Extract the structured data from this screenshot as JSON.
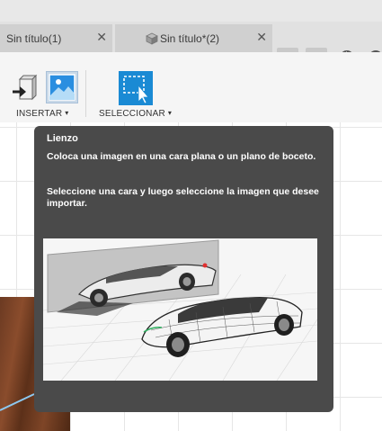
{
  "tabs": [
    {
      "label": "Sin título(1)",
      "close": "✕"
    },
    {
      "label": "Sin título*(2)",
      "close": "✕"
    }
  ],
  "tab_controls": {
    "overflow_icon": "chevron-down-icon",
    "add_label": "+",
    "sync_icon": "refresh-icon"
  },
  "toolbar": {
    "insert": {
      "label": "INSERTAR",
      "caret": "▾"
    },
    "select": {
      "label": "SELECCIONAR",
      "caret": "▾"
    }
  },
  "tooltip": {
    "title": "Lienzo",
    "description": "Coloca una imagen en una cara plana o un plano de boceto.",
    "instruction": "Seleccione una cara y luego seleccione la imagen que desee importar."
  },
  "colors": {
    "accent_blue": "#1a8ad4",
    "tooltip_bg": "#4a4a4a"
  }
}
